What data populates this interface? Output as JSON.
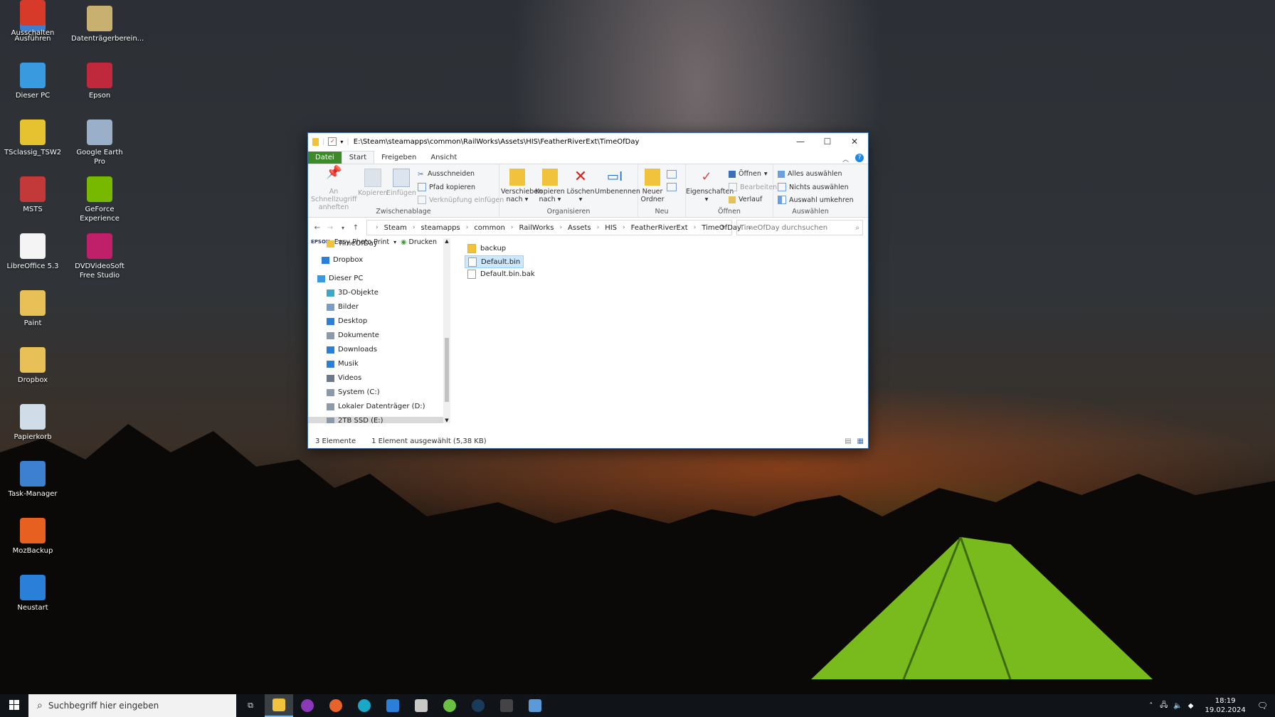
{
  "desktop": {
    "icons": [
      {
        "label": "Ausführen",
        "color": "#3d7fd0"
      },
      {
        "label": "Datenträgerberein...",
        "color": "#c8b070"
      },
      {
        "label": "Dieser PC",
        "color": "#3a9ae0"
      },
      {
        "label": "Epson",
        "color": "#c0283c"
      },
      {
        "label": "TSclassig_TSW2",
        "color": "#e6c230"
      },
      {
        "label": "Google Earth Pro",
        "color": "#9ab0c8"
      },
      {
        "label": "MSTS",
        "color": "#c33838"
      },
      {
        "label": "GeForce Experience",
        "color": "#76b900"
      },
      {
        "label": "LibreOffice 5.3",
        "color": "#f4f4f4"
      },
      {
        "label": "DVDVideoSoft Free Studio",
        "color": "#c0206a"
      },
      {
        "label": "Paint",
        "color": "#e8c058"
      },
      {
        "label": "Dropbox",
        "color": "#e8c058"
      },
      {
        "label": "Papierkorb",
        "color": "#d0dde8"
      },
      {
        "label": "Task-Manager",
        "color": "#3d7fd0"
      },
      {
        "label": "MozBackup",
        "color": "#e86020"
      },
      {
        "label": "Neustart",
        "color": "#2a7fd8"
      },
      {
        "label": "Ausschalten",
        "color": "#d83a2a"
      }
    ]
  },
  "window": {
    "title_path": "E:\\Steam\\steamapps\\common\\RailWorks\\Assets\\HIS\\FeatherRiverExt\\TimeOfDay",
    "tabs": [
      "Datei",
      "Start",
      "Freigeben",
      "Ansicht"
    ],
    "ribbon": {
      "zwischenablage": {
        "label": "Zwischenablage",
        "pin": "An Schnellzugriff anheften",
        "copy": "Kopieren",
        "paste": "Einfügen",
        "cut": "Ausschneiden",
        "copy_path": "Pfad kopieren",
        "paste_shortcut": "Verknüpfung einfügen"
      },
      "organisieren": {
        "label": "Organisieren",
        "move_to": "Verschieben nach",
        "copy_to": "Kopieren nach",
        "delete": "Löschen",
        "rename": "Umbenennen"
      },
      "neu": {
        "label": "Neu",
        "new_folder": "Neuer Ordner"
      },
      "oeffnen": {
        "label": "Öffnen",
        "properties": "Eigenschaften",
        "open": "Öffnen",
        "edit": "Bearbeiten",
        "history": "Verlauf"
      },
      "auswaehlen": {
        "label": "Auswählen",
        "select_all": "Alles auswählen",
        "select_none": "Nichts auswählen",
        "invert": "Auswahl umkehren"
      }
    },
    "address": {
      "crumbs": [
        "Steam",
        "steamapps",
        "common",
        "RailWorks",
        "Assets",
        "HIS",
        "FeatherRiverExt",
        "TimeOfDay"
      ],
      "search_placeholder": "TimeOfDay durchsuchen"
    },
    "epson_bar": {
      "brand": "EPSON",
      "app": "Easy Photo Print",
      "print": "Drucken"
    },
    "tree": [
      "TimeOfDay",
      "Dropbox",
      "Dieser PC",
      "3D-Objekte",
      "Bilder",
      "Desktop",
      "Dokumente",
      "Downloads",
      "Musik",
      "Videos",
      "System (C:)",
      "Lokaler Datenträger (D:)",
      "2TB SSD (E:)"
    ],
    "files": [
      "backup",
      "Default.bin",
      "Default.bin.bak"
    ],
    "status": {
      "count": "3 Elemente",
      "selection": "1 Element ausgewählt (5,38 KB)"
    }
  },
  "taskbar": {
    "search_placeholder": "Suchbegriff hier eingeben",
    "time": "18:19",
    "date": "19.02.2024"
  }
}
